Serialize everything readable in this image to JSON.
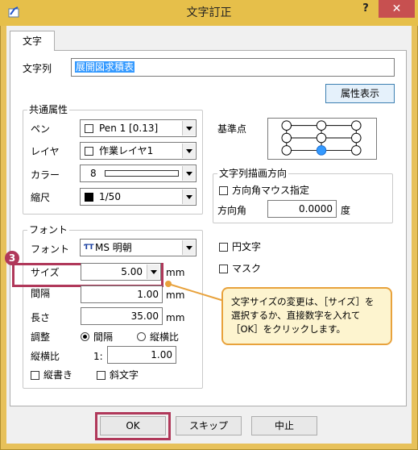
{
  "window": {
    "title": "文字訂正",
    "help": "?",
    "close": "✕"
  },
  "tab": {
    "label": "文字"
  },
  "text_row": {
    "label": "文字列",
    "value": "展開図求積表"
  },
  "attr_button": "属性表示",
  "common": {
    "group_title": "共通属性",
    "pen": {
      "label": "ペン",
      "value": "Pen 1    [0.13]"
    },
    "layer": {
      "label": "レイヤ",
      "value": "作業レイヤ1"
    },
    "color": {
      "label": "カラー",
      "value": "8"
    },
    "scale": {
      "label": "縮尺",
      "value": "1/50"
    }
  },
  "base_point": {
    "label": "基準点",
    "selected": "bottom-center"
  },
  "direction": {
    "group_title": "文字列描画方向",
    "mouse_label": "方向角マウス指定",
    "angle_label": "方向角",
    "angle_value": "0.0000",
    "angle_unit": "度"
  },
  "font": {
    "group_title": "フォント",
    "font_label": "フォント",
    "font_value": "MS 明朝",
    "font_icon": "ƬT",
    "size_label": "サイズ",
    "size_value": "5.00",
    "size_unit": "mm",
    "spacing_label": "間隔",
    "spacing_value": "1.00",
    "spacing_unit": "mm",
    "length_label": "長さ",
    "length_value": "35.00",
    "length_unit": "mm",
    "adjust_label": "調整",
    "adjust_opt1": "間隔",
    "adjust_opt2": "縦横比",
    "ratio_label": "縦横比",
    "ratio_prefix": "1:",
    "ratio_value": "1.00",
    "vertical_label": "縦書き",
    "italic_label": "斜文字"
  },
  "circle_text_label": "円文字",
  "mask_label": "マスク",
  "callout": {
    "badge": "3",
    "text": "文字サイズの変更は、［サイズ］を選択するか、直接数字を入れて［OK］をクリックします。"
  },
  "buttons": {
    "ok": "OK",
    "skip": "スキップ",
    "cancel": "中止"
  }
}
